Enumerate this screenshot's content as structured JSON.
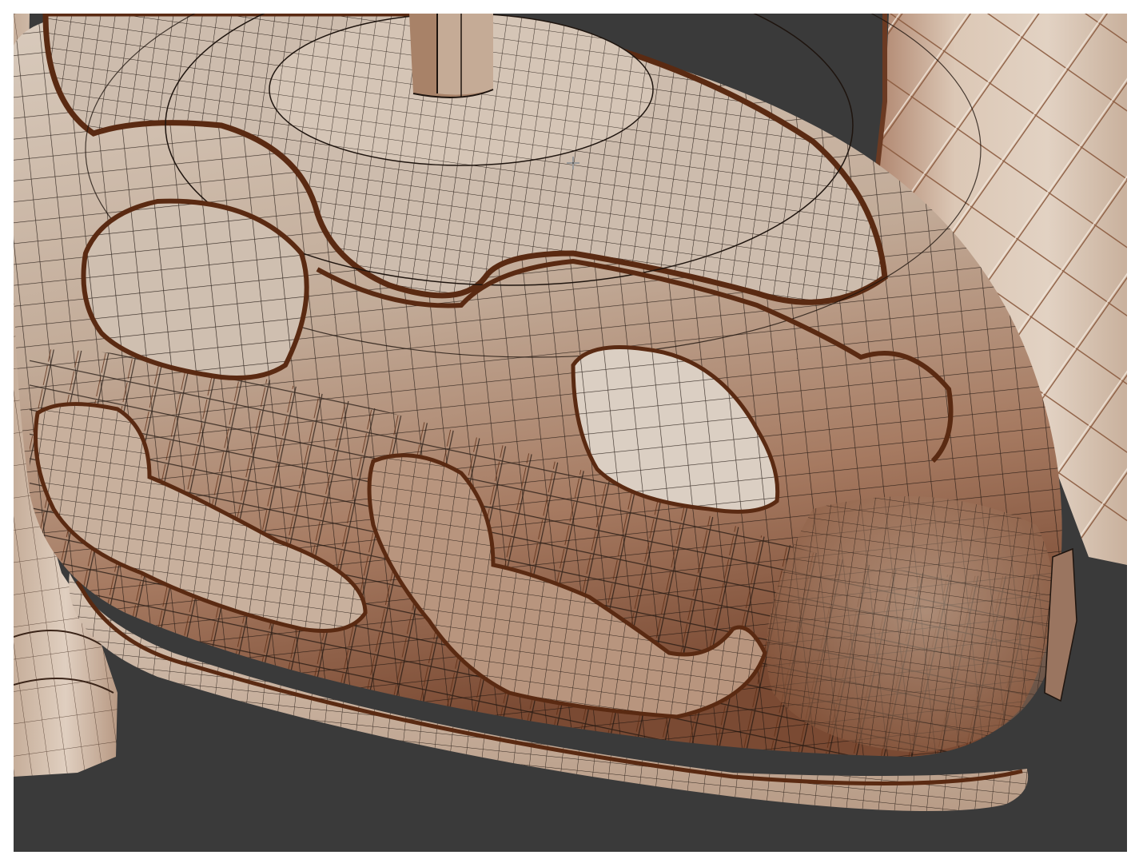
{
  "viewport": {
    "background_color": "#3a3a3a",
    "shading_mode": "solid-wireframe",
    "wire_color": "#1e140e",
    "object_colors": {
      "clay_light": "#d9cbbd",
      "clay_mid": "#b59a86",
      "clay_dark": "#6f4530",
      "crease": "#5a2a12"
    },
    "cursor_icon": "crosshair-cursor-icon"
  }
}
